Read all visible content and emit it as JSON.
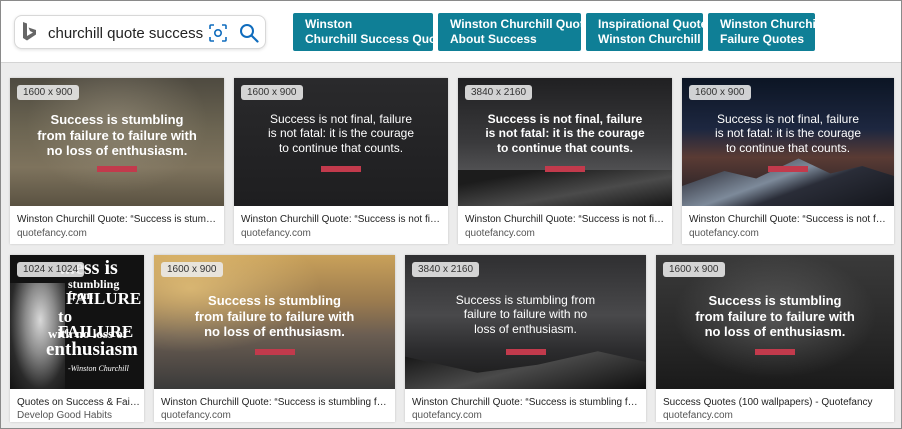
{
  "search": {
    "query": "churchill quote success"
  },
  "related": [
    {
      "line1": "Winston",
      "line2": "Churchill Success Quote"
    },
    {
      "line1": "Winston Churchill Quotes",
      "line2": "About Success"
    },
    {
      "line1": "Inspirational Quotes",
      "line2": "Winston Churchill"
    },
    {
      "line1": "Winston Churchill",
      "line2": "Failure Quotes"
    }
  ],
  "results": [
    {
      "size": "1600 x 900",
      "quote": [
        "Success is stumbling",
        "from failure to failure with",
        "no loss of enthusiasm."
      ],
      "caption": "Winston Churchill Quote: “Success is stumbling f...",
      "domain": "quotefancy.com"
    },
    {
      "size": "1600 x 900",
      "quote": [
        "Success is not final, failure",
        "is not fatal: it is the courage",
        "to continue that counts."
      ],
      "caption": "Winston Churchill Quote: “Success is not final, fa...",
      "domain": "quotefancy.com"
    },
    {
      "size": "3840 x 2160",
      "quote": [
        "Success is not final, failure",
        "is not fatal: it is the courage",
        "to continue that counts."
      ],
      "caption": "Winston Churchill Quote: “Success is not final, fa...",
      "domain": "quotefancy.com"
    },
    {
      "size": "1600 x 900",
      "quote": [
        "Success is not final, failure",
        "is not fatal: it is the courage",
        "to continue that counts."
      ],
      "caption": "Winston Churchill Quote: “Success is not final, fa...",
      "domain": "quotefancy.com"
    },
    {
      "size": "1024 x 1024",
      "quote": [
        "...ess is",
        "stumbling from",
        "FAILURE",
        "to FAILURE",
        "with no loss of",
        "enthusiasm",
        "-Winston Churchill"
      ],
      "caption": "Quotes on Success & Failur...",
      "domain": "Develop Good Habits"
    },
    {
      "size": "1600 x 900",
      "quote": [
        "Success is stumbling",
        "from failure to failure with",
        "no loss of enthusiasm."
      ],
      "caption": "Winston Churchill Quote: “Success is stumbling from failu...",
      "domain": "quotefancy.com"
    },
    {
      "size": "3840 x 2160",
      "quote": [
        "Success is stumbling from",
        "failure to failure with no",
        "loss of enthusiasm."
      ],
      "caption": "Winston Churchill Quote: “Success is stumbling from failu...",
      "domain": "quotefancy.com"
    },
    {
      "size": "1600 x 900",
      "quote": [
        "Success is stumbling",
        "from failure to failure with",
        "no loss of enthusiasm."
      ],
      "caption": "Success Quotes (100 wallpapers) - Quotefancy",
      "domain": "quotefancy.com"
    }
  ]
}
